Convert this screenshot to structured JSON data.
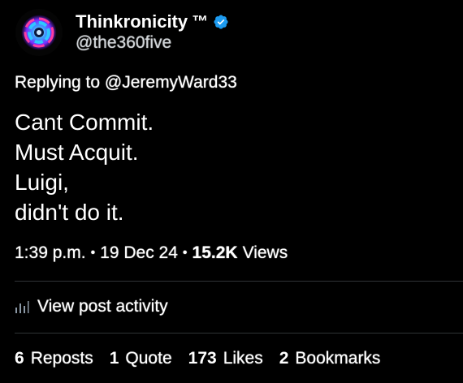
{
  "author": {
    "display_name": "Thinkronicity",
    "trademark": "™",
    "handle": "@the360five",
    "verified": true,
    "verified_color": "#1d9bf0"
  },
  "reply_context": "Replying to @JeremyWard33",
  "tweet_lines": [
    "Cant Commit.",
    "Must Acquit.",
    "Luigi,",
    "didn't do it."
  ],
  "meta": {
    "time": "1:39 p.m.",
    "date": "19 Dec 24",
    "views_count": "15.2K",
    "views_label": "Views"
  },
  "activity_label": "View post activity",
  "stats": [
    {
      "count": "6",
      "label": "Reposts"
    },
    {
      "count": "1",
      "label": "Quote"
    },
    {
      "count": "173",
      "label": "Likes"
    },
    {
      "count": "2",
      "label": "Bookmarks"
    }
  ]
}
